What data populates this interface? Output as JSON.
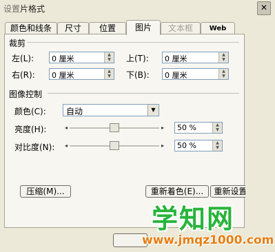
{
  "titlebar": {
    "title_start": "设置",
    "title_rest": "片格式",
    "close_glyph": "✕"
  },
  "tabs": [
    {
      "label": "颜色和线条",
      "active": false,
      "disabled": false
    },
    {
      "label": "尺寸",
      "active": false,
      "disabled": false
    },
    {
      "label": "位置",
      "active": false,
      "disabled": false
    },
    {
      "label": "图片",
      "active": true,
      "disabled": false
    },
    {
      "label": "文本框",
      "active": false,
      "disabled": true
    },
    {
      "label": "Web",
      "active": false,
      "disabled": false
    }
  ],
  "crop": {
    "section_title": "裁剪",
    "left": {
      "label": "左(L):",
      "value": "0 厘米"
    },
    "right": {
      "label": "右(R):",
      "value": "0 厘米"
    },
    "top": {
      "label": "上(T):",
      "value": "0 厘米"
    },
    "bottom": {
      "label": "下(B):",
      "value": "0 厘米"
    }
  },
  "image_control": {
    "section_title": "图像控制",
    "color": {
      "label": "颜色(C):",
      "value": "自动"
    },
    "brightness": {
      "label": "亮度(H):",
      "value": "50 %",
      "level": 0.5
    },
    "contrast": {
      "label": "对比度(N):",
      "value": "50 %",
      "level": 0.5
    }
  },
  "buttons": {
    "compress": "压缩(M)...",
    "recolor": "重新着色(E)...",
    "reset": "重新设置(S)"
  },
  "watermark": {
    "title": "学知网",
    "url": "www.jmqz1000.com"
  },
  "icons": {
    "spin_up": "▲",
    "spin_down": "▼",
    "dropdown": "▼",
    "slider_left": "◂",
    "slider_right": "▸"
  }
}
